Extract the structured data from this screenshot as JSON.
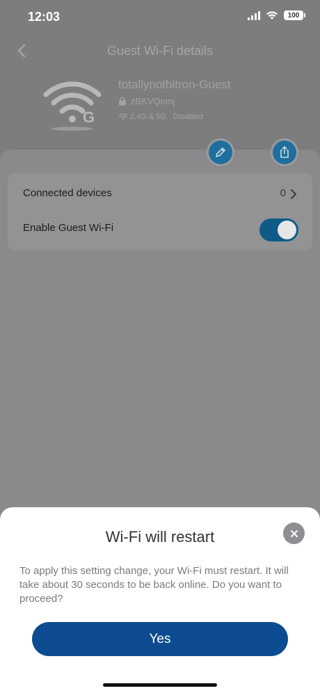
{
  "status_bar": {
    "time": "12:03",
    "battery": "100"
  },
  "nav": {
    "title": "Guest Wi-Fi details"
  },
  "network": {
    "ssid": "totallynothitron-Guest",
    "password": "zBKVQomj",
    "bands": "2.4G & 5G",
    "status": "Disabled",
    "logo_letter": "G"
  },
  "settings": {
    "connected_devices_label": "Connected devices",
    "connected_devices_count": "0",
    "enable_guest_label": "Enable Guest Wi-Fi",
    "enable_guest_on": true
  },
  "dialog": {
    "title": "Wi-Fi will restart",
    "message": "To apply this setting change, your Wi-Fi must restart. It will take about 30 seconds to be back online. Do you want to proceed?",
    "confirm_label": "Yes"
  },
  "colors": {
    "accent": "#0c4b8f",
    "toggle_on": "#0f5b87",
    "fab": "#1f6f9e"
  }
}
